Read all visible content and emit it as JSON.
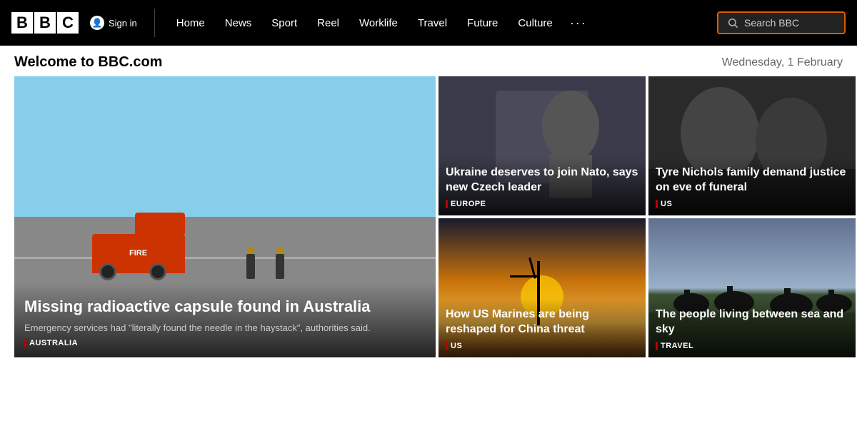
{
  "header": {
    "logo": [
      "B",
      "B",
      "C"
    ],
    "sign_in": "Sign in",
    "nav_items": [
      "Home",
      "News",
      "Sport",
      "Reel",
      "Worklife",
      "Travel",
      "Future",
      "Culture"
    ],
    "more_label": "···",
    "search_placeholder": "Search BBC"
  },
  "welcome": {
    "title": "Welcome to BBC.com",
    "date": "Wednesday, 1 February"
  },
  "cards": [
    {
      "id": "hero",
      "title": "Missing radioactive capsule found in Australia",
      "description": "Emergency services had \"literally found the needle in the haystack\", authorities said.",
      "tag": "AUSTRALIA"
    },
    {
      "id": "ukraine",
      "title": "Ukraine deserves to join Nato, says new Czech leader",
      "tag": "EUROPE"
    },
    {
      "id": "tyre",
      "title": "Tyre Nichols family demand justice on eve of funeral",
      "tag": "US"
    },
    {
      "id": "marines",
      "title": "How US Marines are being reshaped for China threat",
      "tag": "US"
    },
    {
      "id": "travel",
      "title": "The people living between sea and sky",
      "tag": "TRAVEL"
    }
  ]
}
